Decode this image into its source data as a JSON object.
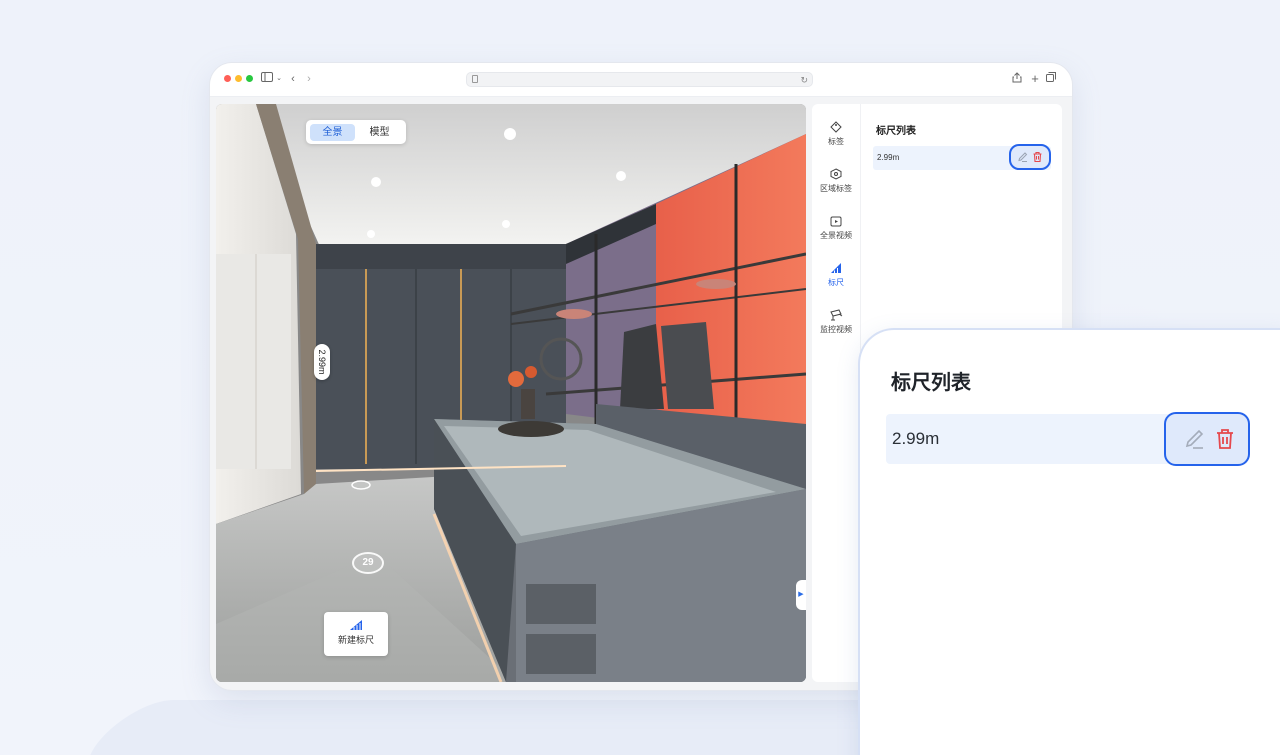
{
  "view_toggle": {
    "panorama": "全景",
    "model": "模型"
  },
  "viewport": {
    "measurement_label": "2.99m",
    "hotspot_number": "29",
    "new_ruler_label": "新建标尺"
  },
  "tool_nav": {
    "items": [
      {
        "label": "标签",
        "icon": "tag-icon"
      },
      {
        "label": "区域标签",
        "icon": "area-tag-icon"
      },
      {
        "label": "全景视频",
        "icon": "panorama-video-icon"
      },
      {
        "label": "标尺",
        "icon": "ruler-icon",
        "active": true
      },
      {
        "label": "监控视频",
        "icon": "surveillance-camera-icon"
      }
    ]
  },
  "ruler_list": {
    "title": "标尺列表",
    "items": [
      {
        "value": "2.99m"
      }
    ]
  },
  "callout": {
    "title": "标尺列表",
    "items": [
      {
        "value": "2.99m"
      }
    ]
  },
  "colors": {
    "accent": "#2563eb",
    "delete": "#e5484d",
    "row_bg": "#edf3fd",
    "wall_orange": "#f06a4f"
  }
}
